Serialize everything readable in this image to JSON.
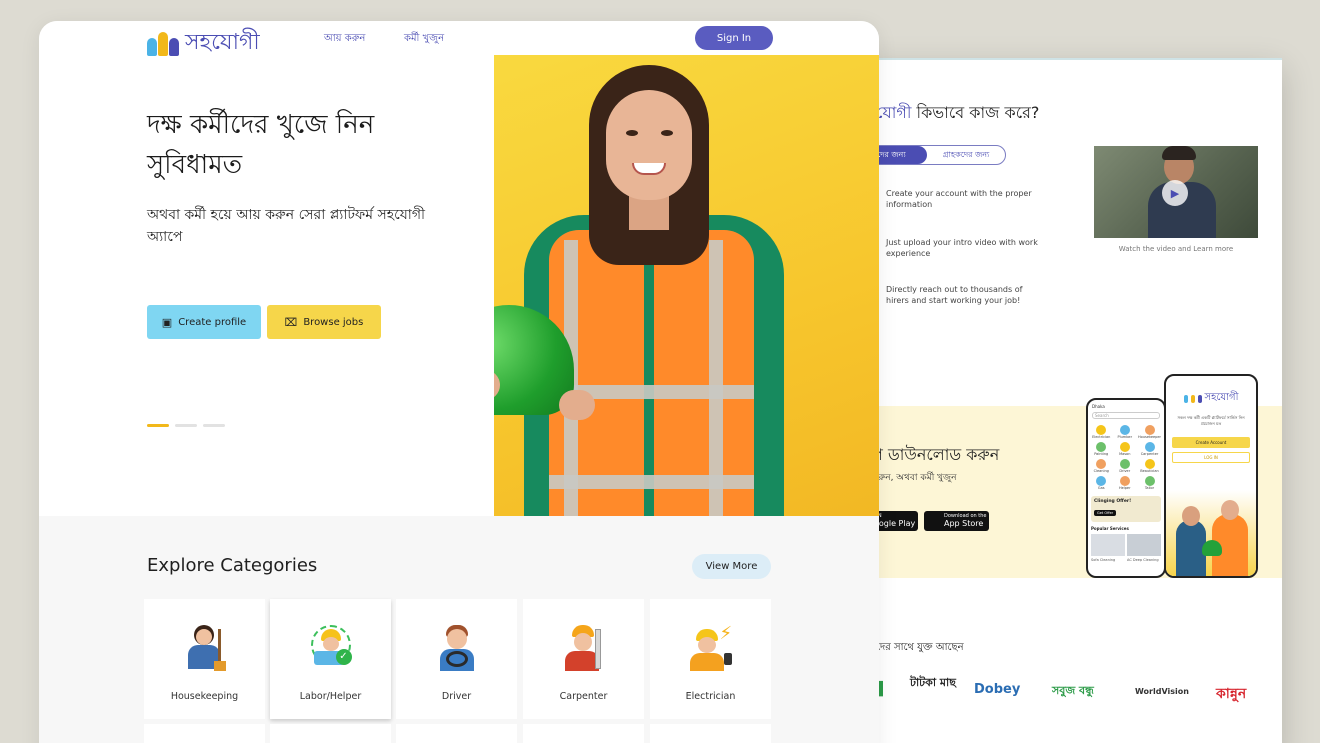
{
  "back_window": {
    "how_title_brand": "যোগী",
    "how_title_rest": " কিভাবে কাজ করে?",
    "toggle": [
      "র্মীদের জন্য",
      "গ্রাহকদের জন্য"
    ],
    "steps": [
      "Create your account with the proper information",
      "Just upload your intro video with work experience",
      "Directly reach out to thousands of hirers and start working your job!"
    ],
    "video_caption": "Watch the video and Learn more",
    "download": {
      "title": "প ডাউনলোড করুন",
      "subtitle": "করুন, অথবা কর্মী খুজুন",
      "google_small": "ON",
      "google_big": "oogle Play",
      "apple_small": "Download on the",
      "apple_big": "App Store"
    },
    "phone_front": {
      "brand": "সহযোগী",
      "tagline": "সকল দক্ষ কর্মী একটি প্ল্যাটফর্মে সার্ভিস নিন প্রয়োজন মত",
      "create_account": "Create Account",
      "login": "LOG IN"
    },
    "phone_back": {
      "location": "Dhaka",
      "search": "Search",
      "offer": "Clinging Offer!",
      "offer_btn": "Get Offer",
      "popular": "Popular Services",
      "svc": [
        "Sofa Cleaning",
        "AC Deep Cleaning"
      ],
      "cats": [
        "Electrician",
        "Plumber",
        "Housekeeper",
        "Painting",
        "Mason",
        "Carpenter",
        "Cleaning",
        "Driver",
        "Beautician",
        "Gas",
        "Helper",
        "Tailor"
      ]
    },
    "partners_title": "দের সাথে যুক্ত আছেন",
    "partners": [
      "টাটকা মাছ",
      "Dobey",
      "সবুজ বন্ধু",
      "WorldVision",
      "কান্নুন"
    ]
  },
  "header": {
    "brand": "সহযোগী",
    "nav": [
      "আয় করুন",
      "কর্মী খুজুন"
    ],
    "signin": "Sign In"
  },
  "hero": {
    "headline": "দক্ষ কর্মীদের খুজে নিন সুবিধামত",
    "subline": "অথবা কর্মী হয়ে আয় করুন সেরা প্ল্যাটফর্ম সহযোগী অ্যাপে",
    "create_profile": "Create profile",
    "browse_jobs": "Browse jobs",
    "slide": 1,
    "slides_total": 3
  },
  "categories": {
    "title": "Explore Categories",
    "view_more": "View More",
    "items": [
      {
        "label": "Housekeeping",
        "icon": "housekeeping-icon"
      },
      {
        "label": "Labor/Helper",
        "icon": "helper-icon"
      },
      {
        "label": "Driver",
        "icon": "driver-icon"
      },
      {
        "label": "Carpenter",
        "icon": "carpenter-icon"
      },
      {
        "label": "Electrician",
        "icon": "electrician-icon"
      }
    ]
  },
  "colors": {
    "brand": "#4b4db3",
    "create_profile_bg": "#7fd6f2",
    "browse_jobs_bg": "#f6d64a",
    "hero_bg": "#f7c62d",
    "accent_dot": "#f2b81a"
  }
}
